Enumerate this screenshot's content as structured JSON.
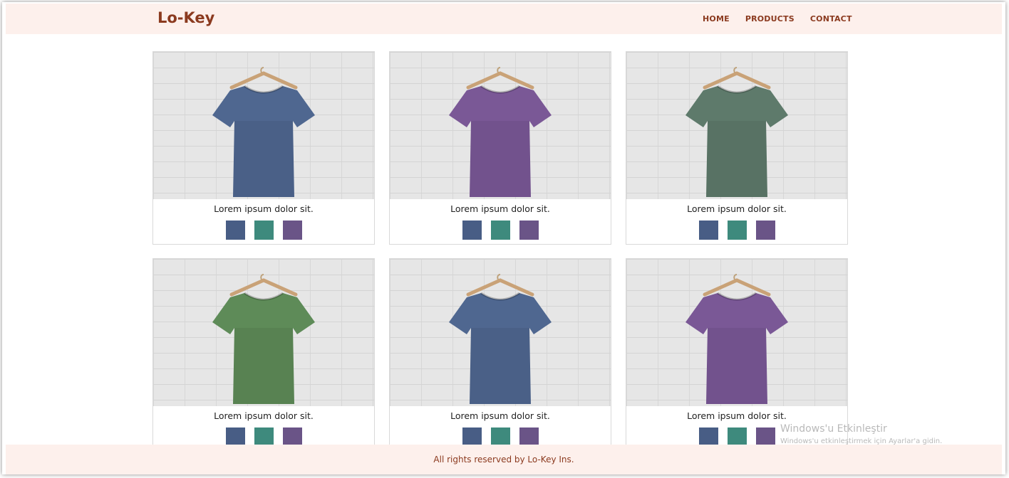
{
  "header": {
    "brand": "Lo-Key",
    "nav": [
      "HOME",
      "PRODUCTS",
      "CONTACT"
    ],
    "background_color": "#fdf0ec",
    "accent_color": "#8b3a1f"
  },
  "swatch_colors": [
    "#485d85",
    "#3e8a7d",
    "#6a5487"
  ],
  "products": [
    {
      "caption": "Lorem ipsum dolor sit.",
      "shirt_color": "#4f6790",
      "image": "blue-tshirt-on-hanger"
    },
    {
      "caption": "Lorem ipsum dolor sit.",
      "shirt_color": "#7a5896",
      "image": "purple-tshirt-on-hanger"
    },
    {
      "caption": "Lorem ipsum dolor sit.",
      "shirt_color": "#5e7a6b",
      "image": "grey-green-tshirt-on-hanger"
    },
    {
      "caption": "Lorem ipsum dolor sit.",
      "shirt_color": "#5e8b58",
      "image": "green-tshirt-on-hanger"
    },
    {
      "caption": "Lorem ipsum dolor sit.",
      "shirt_color": "#4f6790",
      "image": "blue-tshirt-on-hanger"
    },
    {
      "caption": "Lorem ipsum dolor sit.",
      "shirt_color": "#7a5896",
      "image": "purple-tshirt-on-hanger"
    }
  ],
  "footer": {
    "text": "All rights reserved by Lo-Key Ins."
  },
  "watermark": {
    "title": "Windows'u Etkinleştir",
    "subtitle": "Windows'u etkinleştirmek için Ayarlar'a gidin."
  }
}
